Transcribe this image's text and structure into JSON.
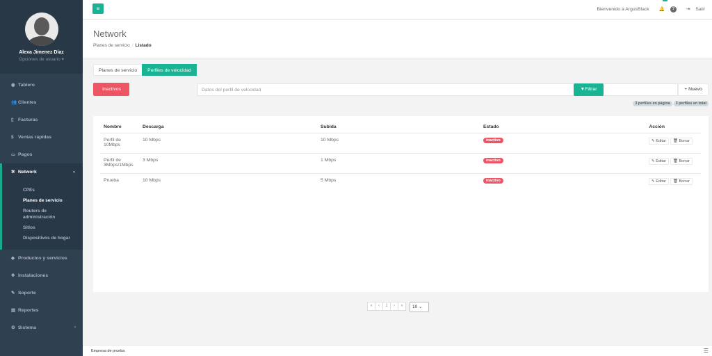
{
  "profile": {
    "name": "Alexa Jimenez Díaz",
    "options": "Opciones de usuario ▾"
  },
  "sidebar": {
    "items": [
      {
        "label": "Tablero",
        "icon": "dashboard-icon"
      },
      {
        "label": "Clientes",
        "icon": "users-icon"
      },
      {
        "label": "Facturas",
        "icon": "file-icon"
      },
      {
        "label": "Ventas rápidas",
        "icon": "dollar-icon"
      },
      {
        "label": "Pagos",
        "icon": "money-icon"
      },
      {
        "label": "Network",
        "icon": "network-icon"
      },
      {
        "label": "Productos y servicios",
        "icon": "tag-icon"
      },
      {
        "label": "Instalaciones",
        "icon": "wrench-icon"
      },
      {
        "label": "Soporte",
        "icon": "support-icon"
      },
      {
        "label": "Reportes",
        "icon": "report-icon"
      },
      {
        "label": "Sistema",
        "icon": "settings-icon"
      }
    ],
    "network_sub": [
      "CPEs",
      "Planes de servicio",
      "Routers de administración",
      "Sitios",
      "Dispositivos de hogar"
    ]
  },
  "topbar": {
    "welcome": "Bienvenido a ArgusBlack",
    "notif_count": "1",
    "logout": "Salir"
  },
  "heading": {
    "title": "Network",
    "crumb_1": "Planes de servicio",
    "crumb_2": "Listado"
  },
  "tabs": [
    "Planes de servicio",
    "Perfiles de velocidad"
  ],
  "filters": {
    "inactivos": "Inactivos",
    "search_placeholder": "Datos del perfil de velocidad",
    "filter_btn": "Filtrar",
    "new_btn": "Nuevo",
    "per_page_badge": "3 perfiles en página",
    "total_badge": "3 perfiles en total"
  },
  "table": {
    "headers": [
      "Nombre",
      "Descarga",
      "Subida",
      "Estado",
      "Acción"
    ],
    "rows": [
      {
        "name": "Perfil de 10Mbps",
        "down": "10 Mbps",
        "up": "10 Mbps",
        "status": "inactivo"
      },
      {
        "name": "Perfil de 3Mbps/1Mbps",
        "down": "3 Mbps",
        "up": "1 Mbps",
        "status": "inactivo"
      },
      {
        "name": "Prueba",
        "down": "10 Mbps",
        "up": "5 Mbps",
        "status": "inactivo"
      }
    ],
    "edit_label": "Editar",
    "delete_label": "Borrar"
  },
  "pagination": {
    "first": "«",
    "prev": "‹",
    "page": "1",
    "next": "›",
    "last": "»",
    "page_size": "10"
  },
  "footer": {
    "text": "Empresa de prueba"
  }
}
